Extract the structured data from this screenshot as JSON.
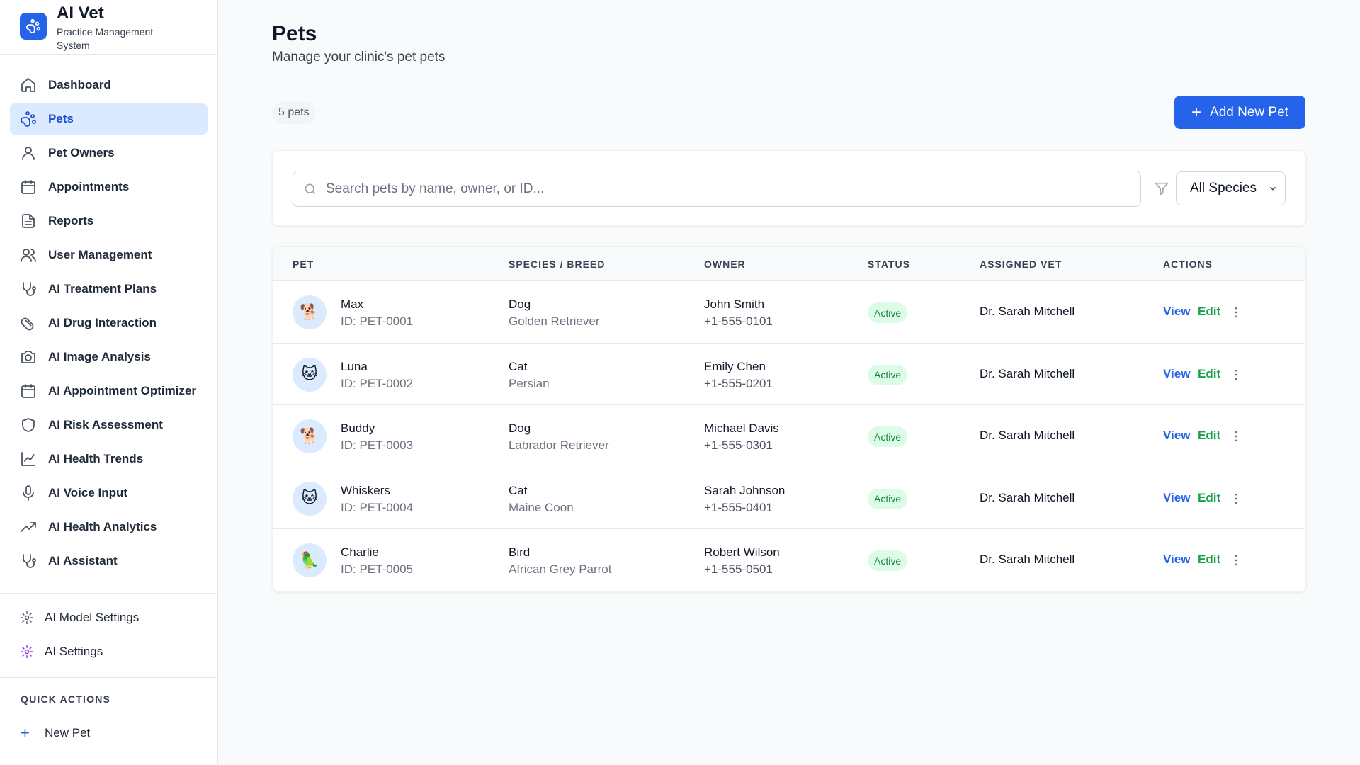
{
  "brand": {
    "title": "AI Vet",
    "subtitle": "Practice Management System"
  },
  "nav": [
    {
      "label": "Dashboard",
      "icon": "home-icon",
      "active": false
    },
    {
      "label": "Pets",
      "icon": "paw-icon",
      "active": true
    },
    {
      "label": "Pet Owners",
      "icon": "user-icon",
      "active": false
    },
    {
      "label": "Appointments",
      "icon": "calendar-icon",
      "active": false
    },
    {
      "label": "Reports",
      "icon": "file-text-icon",
      "active": false
    },
    {
      "label": "User Management",
      "icon": "users-icon",
      "active": false
    },
    {
      "label": "AI Treatment Plans",
      "icon": "stethoscope-icon",
      "active": false
    },
    {
      "label": "AI Drug Interaction",
      "icon": "pill-icon",
      "active": false
    },
    {
      "label": "AI Image Analysis",
      "icon": "camera-icon",
      "active": false
    },
    {
      "label": "AI Appointment Optimizer",
      "icon": "calendar-icon",
      "active": false
    },
    {
      "label": "AI Risk Assessment",
      "icon": "shield-icon",
      "active": false
    },
    {
      "label": "AI Health Trends",
      "icon": "line-chart-icon",
      "active": false
    },
    {
      "label": "AI Voice Input",
      "icon": "mic-icon",
      "active": false
    },
    {
      "label": "AI Health Analytics",
      "icon": "trending-up-icon",
      "active": false
    },
    {
      "label": "AI Assistant",
      "icon": "stethoscope-icon",
      "active": false
    }
  ],
  "settings": [
    {
      "label": "AI Model Settings",
      "icon": "gear-icon",
      "color": "#4b5563"
    },
    {
      "label": "AI Settings",
      "icon": "gear-icon",
      "color": "#9333ea"
    }
  ],
  "quick_actions": {
    "title": "QUICK ACTIONS",
    "items": [
      "New Pet"
    ]
  },
  "header": {
    "title": "Pets",
    "subtitle": "Manage your clinic's pet pets",
    "count": "5 pets",
    "add_button": "Add New Pet"
  },
  "search": {
    "placeholder": "Search pets by name, owner, or ID...",
    "species_filter": "All Species"
  },
  "table": {
    "columns": [
      "PET",
      "SPECIES / BREED",
      "OWNER",
      "STATUS",
      "ASSIGNED VET",
      "ACTIONS"
    ],
    "view_label": "View",
    "edit_label": "Edit",
    "rows": [
      {
        "emoji": "🐕",
        "name": "Max",
        "id": "ID: PET-0001",
        "species": "Dog",
        "breed": "Golden Retriever",
        "owner": "John Smith",
        "phone": "+1-555-0101",
        "status": "Active",
        "vet": "Dr. Sarah Mitchell"
      },
      {
        "emoji": "🐱",
        "name": "Luna",
        "id": "ID: PET-0002",
        "species": "Cat",
        "breed": "Persian",
        "owner": "Emily Chen",
        "phone": "+1-555-0201",
        "status": "Active",
        "vet": "Dr. Sarah Mitchell"
      },
      {
        "emoji": "🐕",
        "name": "Buddy",
        "id": "ID: PET-0003",
        "species": "Dog",
        "breed": "Labrador Retriever",
        "owner": "Michael Davis",
        "phone": "+1-555-0301",
        "status": "Active",
        "vet": "Dr. Sarah Mitchell"
      },
      {
        "emoji": "🐱",
        "name": "Whiskers",
        "id": "ID: PET-0004",
        "species": "Cat",
        "breed": "Maine Coon",
        "owner": "Sarah Johnson",
        "phone": "+1-555-0401",
        "status": "Active",
        "vet": "Dr. Sarah Mitchell"
      },
      {
        "emoji": "🦜",
        "name": "Charlie",
        "id": "ID: PET-0005",
        "species": "Bird",
        "breed": "African Grey Parrot",
        "owner": "Robert Wilson",
        "phone": "+1-555-0501",
        "status": "Active",
        "vet": "Dr. Sarah Mitchell"
      }
    ]
  }
}
